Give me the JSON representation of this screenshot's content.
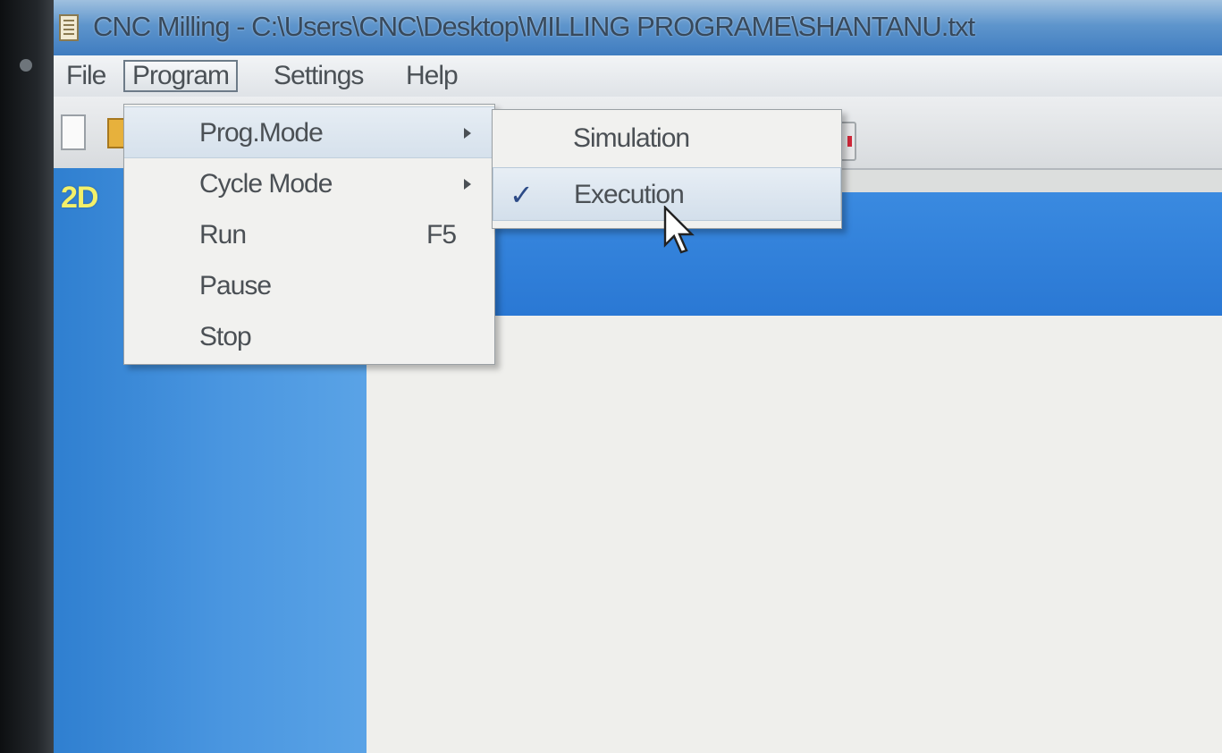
{
  "window": {
    "title": "CNC Milling - C:\\Users\\CNC\\Desktop\\MILLING PROGRAME\\SHANTANU.txt"
  },
  "menubar": {
    "items": [
      {
        "label": "File"
      },
      {
        "label": "Program",
        "active": true
      },
      {
        "label": "Settings"
      },
      {
        "label": "Help"
      }
    ]
  },
  "program_menu": {
    "items": [
      {
        "label": "Prog.Mode",
        "submenu": true,
        "highlighted": true
      },
      {
        "label": "Cycle Mode",
        "submenu": true
      },
      {
        "label": "Run",
        "shortcut": "F5"
      },
      {
        "label": "Pause"
      },
      {
        "label": "Stop"
      }
    ]
  },
  "prog_mode_submenu": {
    "items": [
      {
        "label": "Simulation",
        "checked": false
      },
      {
        "label": "Execution",
        "checked": true,
        "highlighted": true
      }
    ]
  },
  "view": {
    "badge": "2D"
  },
  "colors": {
    "title_bar": "#5e95cc",
    "panel_blue": "#3a8ae0",
    "badge_yellow": "#f3f06a",
    "check_mark": "#2d4b87"
  },
  "icons": {
    "app": "notepad-icon",
    "submenu_arrow": "triangle-right-icon",
    "check": "checkmark-icon",
    "pointer": "mouse-cursor-icon"
  }
}
